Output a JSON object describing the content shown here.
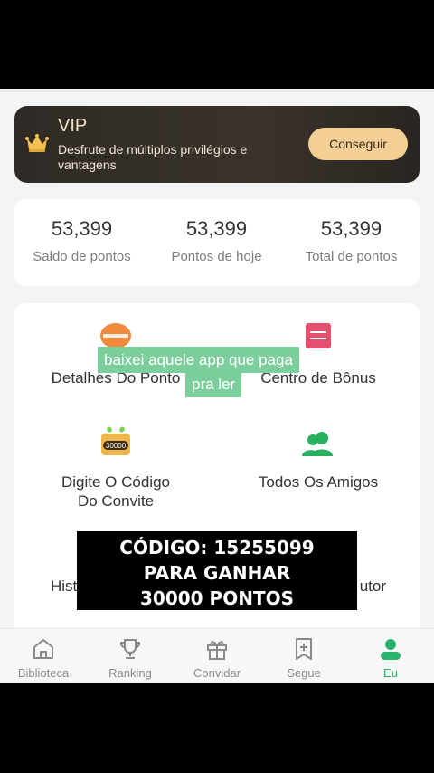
{
  "vip": {
    "title": "VIP",
    "description": "Desfrute de múltiplos privilégios e vantagens",
    "button_label": "Conseguir",
    "icon": "crown-icon"
  },
  "points": [
    {
      "value": "53,399",
      "label": "Saldo de pontos"
    },
    {
      "value": "53,399",
      "label": "Pontos de hoje"
    },
    {
      "value": "53,399",
      "label": "Total de pontos"
    }
  ],
  "menu": [
    {
      "label": "Detalhes Do Ponto",
      "icon": "coins-icon"
    },
    {
      "label": "Centro de Bônus",
      "icon": "checklist-icon"
    },
    {
      "label_line1": "Digite O Código",
      "label_line2": "Do Convite",
      "icon": "gift-code-icon"
    },
    {
      "label": "Todos Os Amigos",
      "icon": "friends-icon"
    },
    {
      "label": "Hist",
      "icon": "history-icon"
    },
    {
      "label": "utor",
      "icon": "author-icon"
    }
  ],
  "overlay": {
    "caption_line1": "baixei aquele app que paga",
    "caption_line2": "pra ler",
    "promo_line1": "CÓDIGO: 15255099",
    "promo_line2": "PARA GANHAR",
    "promo_line3": "30000 PONTOS"
  },
  "tabs": [
    {
      "label": "Biblioteca",
      "icon": "home-icon"
    },
    {
      "label": "Ranking",
      "icon": "trophy-icon"
    },
    {
      "label": "Convidar",
      "icon": "gift-icon"
    },
    {
      "label": "Segue",
      "icon": "bookmark-icon"
    },
    {
      "label": "Eu",
      "icon": "user-icon",
      "active": true
    }
  ],
  "colors": {
    "accent_green": "#27b46b",
    "vip_button": "#f3cf95",
    "caption_bg": "#7ccf9c"
  },
  "gift_badge": "30000"
}
